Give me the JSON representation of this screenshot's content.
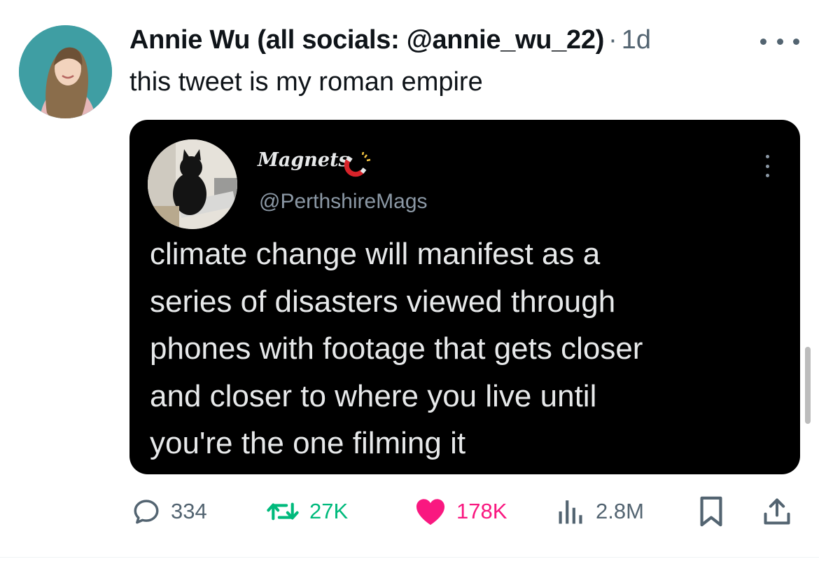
{
  "tweet": {
    "author": {
      "name": "Annie Wu (all socials: @annie_wu_22)",
      "avatar_icon": "profile-photo"
    },
    "separator": "·",
    "timestamp": "1d",
    "text": "this tweet is my roman empire",
    "more_icon": "more-horizontal-icon"
  },
  "quoted": {
    "name": "Magnets",
    "name_icon": "magnet-icon",
    "handle": "@PerthshireMags",
    "text": "climate change will manifest as a\nseries of disasters viewed through\nphones with footage that gets closer\nand closer to where you live until\nyou're the one filming it",
    "more_icon": "more-vertical-icon"
  },
  "actions": {
    "reply": {
      "icon": "reply-icon",
      "count": "334"
    },
    "repost": {
      "icon": "repost-icon",
      "count": "27K"
    },
    "like": {
      "icon": "heart-icon",
      "count": "178K"
    },
    "views": {
      "icon": "views-icon",
      "count": "2.8M"
    },
    "bookmark": {
      "icon": "bookmark-icon"
    },
    "share": {
      "icon": "share-icon"
    }
  },
  "colors": {
    "text": "#0f1419",
    "secondary": "#536471",
    "repost": "#00ba7c",
    "like": "#f91880",
    "quote_bg": "#000000"
  }
}
